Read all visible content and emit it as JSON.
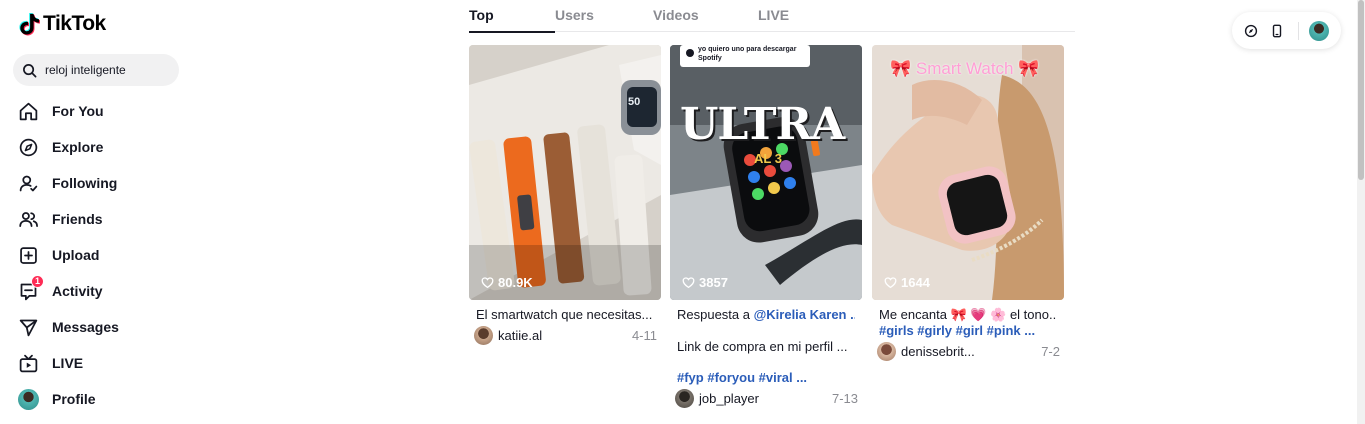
{
  "app": {
    "name": "TikTok"
  },
  "search": {
    "value": "reloj inteligente"
  },
  "nav": [
    {
      "label": "For You",
      "icon": "home-icon"
    },
    {
      "label": "Explore",
      "icon": "compass-icon"
    },
    {
      "label": "Following",
      "icon": "following-icon"
    },
    {
      "label": "Friends",
      "icon": "friends-icon"
    },
    {
      "label": "Upload",
      "icon": "upload-icon"
    },
    {
      "label": "Activity",
      "icon": "activity-icon",
      "badge": "1"
    },
    {
      "label": "Messages",
      "icon": "messages-icon"
    },
    {
      "label": "LIVE",
      "icon": "live-icon"
    },
    {
      "label": "Profile",
      "icon": "avatar"
    }
  ],
  "tabs": [
    "Top",
    "Users",
    "Videos",
    "LIVE"
  ],
  "active_tab": "Top",
  "videos": [
    {
      "likes": "80.9K",
      "desc": "El smartwatch que necesitas...",
      "user": "katiie.al",
      "date": "4-11"
    },
    {
      "likes": "3857",
      "overlay_note": "yo quiero uno para descargar Spotify",
      "overlay_title": "ULTRA",
      "overlay_sub": "AL 3",
      "desc_prefix": "Respuesta a ",
      "mention": "@Kirelia Karen ...",
      "desc2": "Link de compra en mi perfil ...",
      "tags": "#fyp #foryou #viral ...",
      "user": "job_player",
      "date": "7-13"
    },
    {
      "likes": "1644",
      "overlay_title": "🎀 Smart Watch 🎀",
      "desc": "Me encanta 🎀 💗 🌸 el tono...",
      "tags": "#girls #girly #girl #pink ...",
      "user": "denissebrit...",
      "date": "7-2"
    }
  ],
  "colors": {
    "accent": "#fe2c55",
    "hashtag": "#2b5db9",
    "muted": "#8a8b91"
  }
}
